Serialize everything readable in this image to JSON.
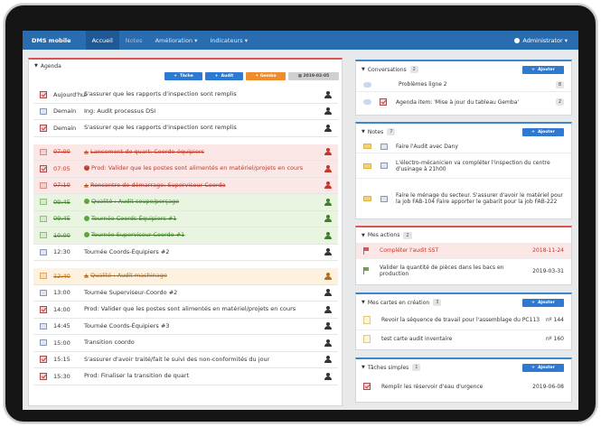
{
  "nav": {
    "brand": "DMS mobile",
    "items": [
      {
        "label": "Accueil",
        "active": true
      },
      {
        "label": "Notes",
        "dim": true
      },
      {
        "label": "Amélioration ▾"
      },
      {
        "label": "Indicateurs ▾"
      }
    ],
    "user": "Administrator ▾"
  },
  "agenda": {
    "title": "Agenda",
    "buttons": {
      "tache": "Tâche",
      "audit": "Audit",
      "gemba": "Gemba",
      "date": "2019-02-05"
    },
    "rows": [
      {
        "icon": "check",
        "time": "Aujourd'hui",
        "text": "S'assurer que les rapports d'inspection sont remplis",
        "style": "normal",
        "strike": false,
        "prefix": ""
      },
      {
        "icon": "cal",
        "time": "Demain",
        "text": "Ing: Audit processus DSI",
        "style": "normal",
        "strike": false,
        "prefix": ""
      },
      {
        "icon": "check",
        "time": "Demain",
        "text": "S'assurer que les rapports d'inspection sont remplis",
        "style": "normal",
        "strike": false,
        "prefix": ""
      },
      {
        "icon": "cal",
        "time": "07:00",
        "text": "Lancement de quart: Coordo-équipiers",
        "style": "red",
        "strike": true,
        "prefix": "warn"
      },
      {
        "icon": "check",
        "time": "07:05",
        "text": "Prod: Valider que les postes sont alimentés en matériel/projets en cours",
        "style": "red",
        "strike": false,
        "prefix": "exc"
      },
      {
        "icon": "cal",
        "time": "07:10",
        "text": "Rencontre de démarrage: Superviseur Coordo",
        "style": "red",
        "strike": true,
        "prefix": "warn"
      },
      {
        "icon": "cal",
        "time": "09:45",
        "text": "Qualité : Audit coupe/perçage",
        "style": "green",
        "strike": true,
        "prefix": "ok"
      },
      {
        "icon": "cal",
        "time": "09:45",
        "text": "Tournée Coords-Équipiers #1",
        "style": "green",
        "strike": true,
        "prefix": "ok"
      },
      {
        "icon": "cal",
        "time": "10:00",
        "text": "Tournée Superviseur-Coordo #1",
        "style": "green",
        "strike": true,
        "prefix": "ok"
      },
      {
        "icon": "cal",
        "time": "12:30",
        "text": "Tournée Coords-Équipiers #2",
        "style": "normal",
        "strike": false,
        "prefix": ""
      },
      {
        "icon": "cal",
        "time": "12:40",
        "text": "Qualité : Audit machinage",
        "style": "orange",
        "strike": true,
        "prefix": "warn"
      },
      {
        "icon": "cal",
        "time": "13:00",
        "text": "Tournée Superviseur-Coordo #2",
        "style": "normal",
        "strike": false,
        "prefix": ""
      },
      {
        "icon": "check",
        "time": "14:00",
        "text": "Prod: Valider que les postes sont alimentés en matériel/projets en cours",
        "style": "normal",
        "strike": false,
        "prefix": ""
      },
      {
        "icon": "cal",
        "time": "14:45",
        "text": "Tournée Coords-Équipiers #3",
        "style": "normal",
        "strike": false,
        "prefix": ""
      },
      {
        "icon": "cal",
        "time": "15:00",
        "text": "Transition coordo",
        "style": "normal",
        "strike": false,
        "prefix": ""
      },
      {
        "icon": "check",
        "time": "15:15",
        "text": "S'assurer d'avoir traité/fait le suivi des non-conformités du jour",
        "style": "normal",
        "strike": false,
        "prefix": ""
      },
      {
        "icon": "check",
        "time": "15:30",
        "text": "Prod: Finaliser la transition de quart",
        "style": "normal",
        "strike": false,
        "prefix": ""
      }
    ]
  },
  "conversations": {
    "title": "Conversations",
    "count": "2",
    "add": "Ajouter",
    "items": [
      {
        "text": "Problèmes ligne 2",
        "count": "8"
      },
      {
        "text": "Agenda item: 'Mise à jour du tableau Gemba'",
        "count": "2"
      }
    ]
  },
  "notes": {
    "title": "Notes",
    "count": "7",
    "add": "Ajouter",
    "items": [
      {
        "text": "Faire l'Audit avec Dany"
      },
      {
        "text": "L'électro-mécanicien va compléter l'inspection du centre d'usinage à 21h00"
      },
      {
        "text": "Faire le ménage du secteur. S'assurer d'avoir le matériel pour la job FAB-104 Faire apporter le gabarit pour la job FAB-222"
      }
    ]
  },
  "actions": {
    "title": "Mes actions",
    "count": "2",
    "items": [
      {
        "text": "Compléter l'audit SST",
        "date": "2018-11-24",
        "late": true
      },
      {
        "text": "Valider la quantité de pièces dans les bacs en production",
        "date": "2019-03-31",
        "late": false
      }
    ]
  },
  "cards": {
    "title": "Mes cartes en création",
    "count": "3",
    "add": "Ajouter",
    "items": [
      {
        "text": "Revoir la séquence de travail pour l'assemblage du PC113",
        "no": "nº 144"
      },
      {
        "text": "test carte audit inventaire",
        "no": "nº 160"
      }
    ]
  },
  "tasks": {
    "title": "Tâches simples",
    "count": "1",
    "add": "Ajouter",
    "items": [
      {
        "text": "Remplir les réservoir d'eau d'urgence",
        "date": "2019-06-08"
      }
    ]
  },
  "colors": {
    "nav": "#2a6cb0",
    "red": "#d9534f",
    "blue": "#3b86d1",
    "green": "#3f7f2a",
    "orange": "#ef8c2b"
  }
}
